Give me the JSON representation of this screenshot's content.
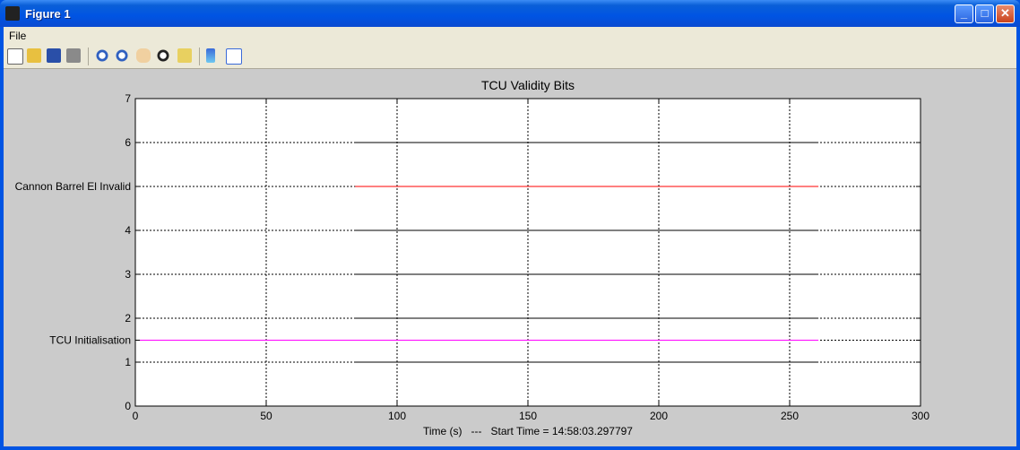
{
  "window": {
    "title": "Figure 1"
  },
  "menu": {
    "file": "File"
  },
  "toolbar": {
    "icons": [
      "new-figure-icon",
      "open-file-icon",
      "save-icon",
      "print-icon",
      "zoom-in-icon",
      "zoom-out-icon",
      "pan-icon",
      "rotate-3d-icon",
      "data-cursor-icon",
      "colorbar-icon",
      "legend-icon"
    ]
  },
  "chart_data": {
    "type": "line",
    "title": "TCU Validity Bits",
    "xlabel": "Time (s)   ---   Start Time = 14:58:03.297797",
    "ylabel": "",
    "xlim": [
      0,
      300
    ],
    "ylim": [
      0,
      7
    ],
    "xticks": [
      0,
      50,
      100,
      150,
      200,
      250,
      300
    ],
    "yticks": [
      {
        "value": 0,
        "label": "0"
      },
      {
        "value": 1,
        "label": "1"
      },
      {
        "value": 1.5,
        "label": "TCU Initialisation"
      },
      {
        "value": 2,
        "label": "2"
      },
      {
        "value": 3,
        "label": "3"
      },
      {
        "value": 4,
        "label": "4"
      },
      {
        "value": 5,
        "label": "Cannon Barrel El Invalid"
      },
      {
        "value": 6,
        "label": "6"
      },
      {
        "value": 7,
        "label": "7"
      }
    ],
    "grid": true,
    "series": [
      {
        "color": "#000000",
        "x": [
          84,
          261
        ],
        "y": [
          1,
          1
        ]
      },
      {
        "color": "#ff00ff",
        "x": [
          0,
          261
        ],
        "y": [
          1.5,
          1.5
        ]
      },
      {
        "color": "#000000",
        "x": [
          84,
          261
        ],
        "y": [
          2,
          2
        ]
      },
      {
        "color": "#000000",
        "x": [
          84,
          261
        ],
        "y": [
          3,
          3
        ]
      },
      {
        "color": "#000000",
        "x": [
          84,
          261
        ],
        "y": [
          4,
          4
        ]
      },
      {
        "color": "#ff0000",
        "x": [
          84,
          261
        ],
        "y": [
          5,
          5
        ]
      },
      {
        "color": "#000000",
        "x": [
          84,
          261
        ],
        "y": [
          6,
          6
        ]
      },
      {
        "color": "#000000",
        "x": [
          84,
          261
        ],
        "y": [
          7,
          7
        ]
      }
    ]
  }
}
